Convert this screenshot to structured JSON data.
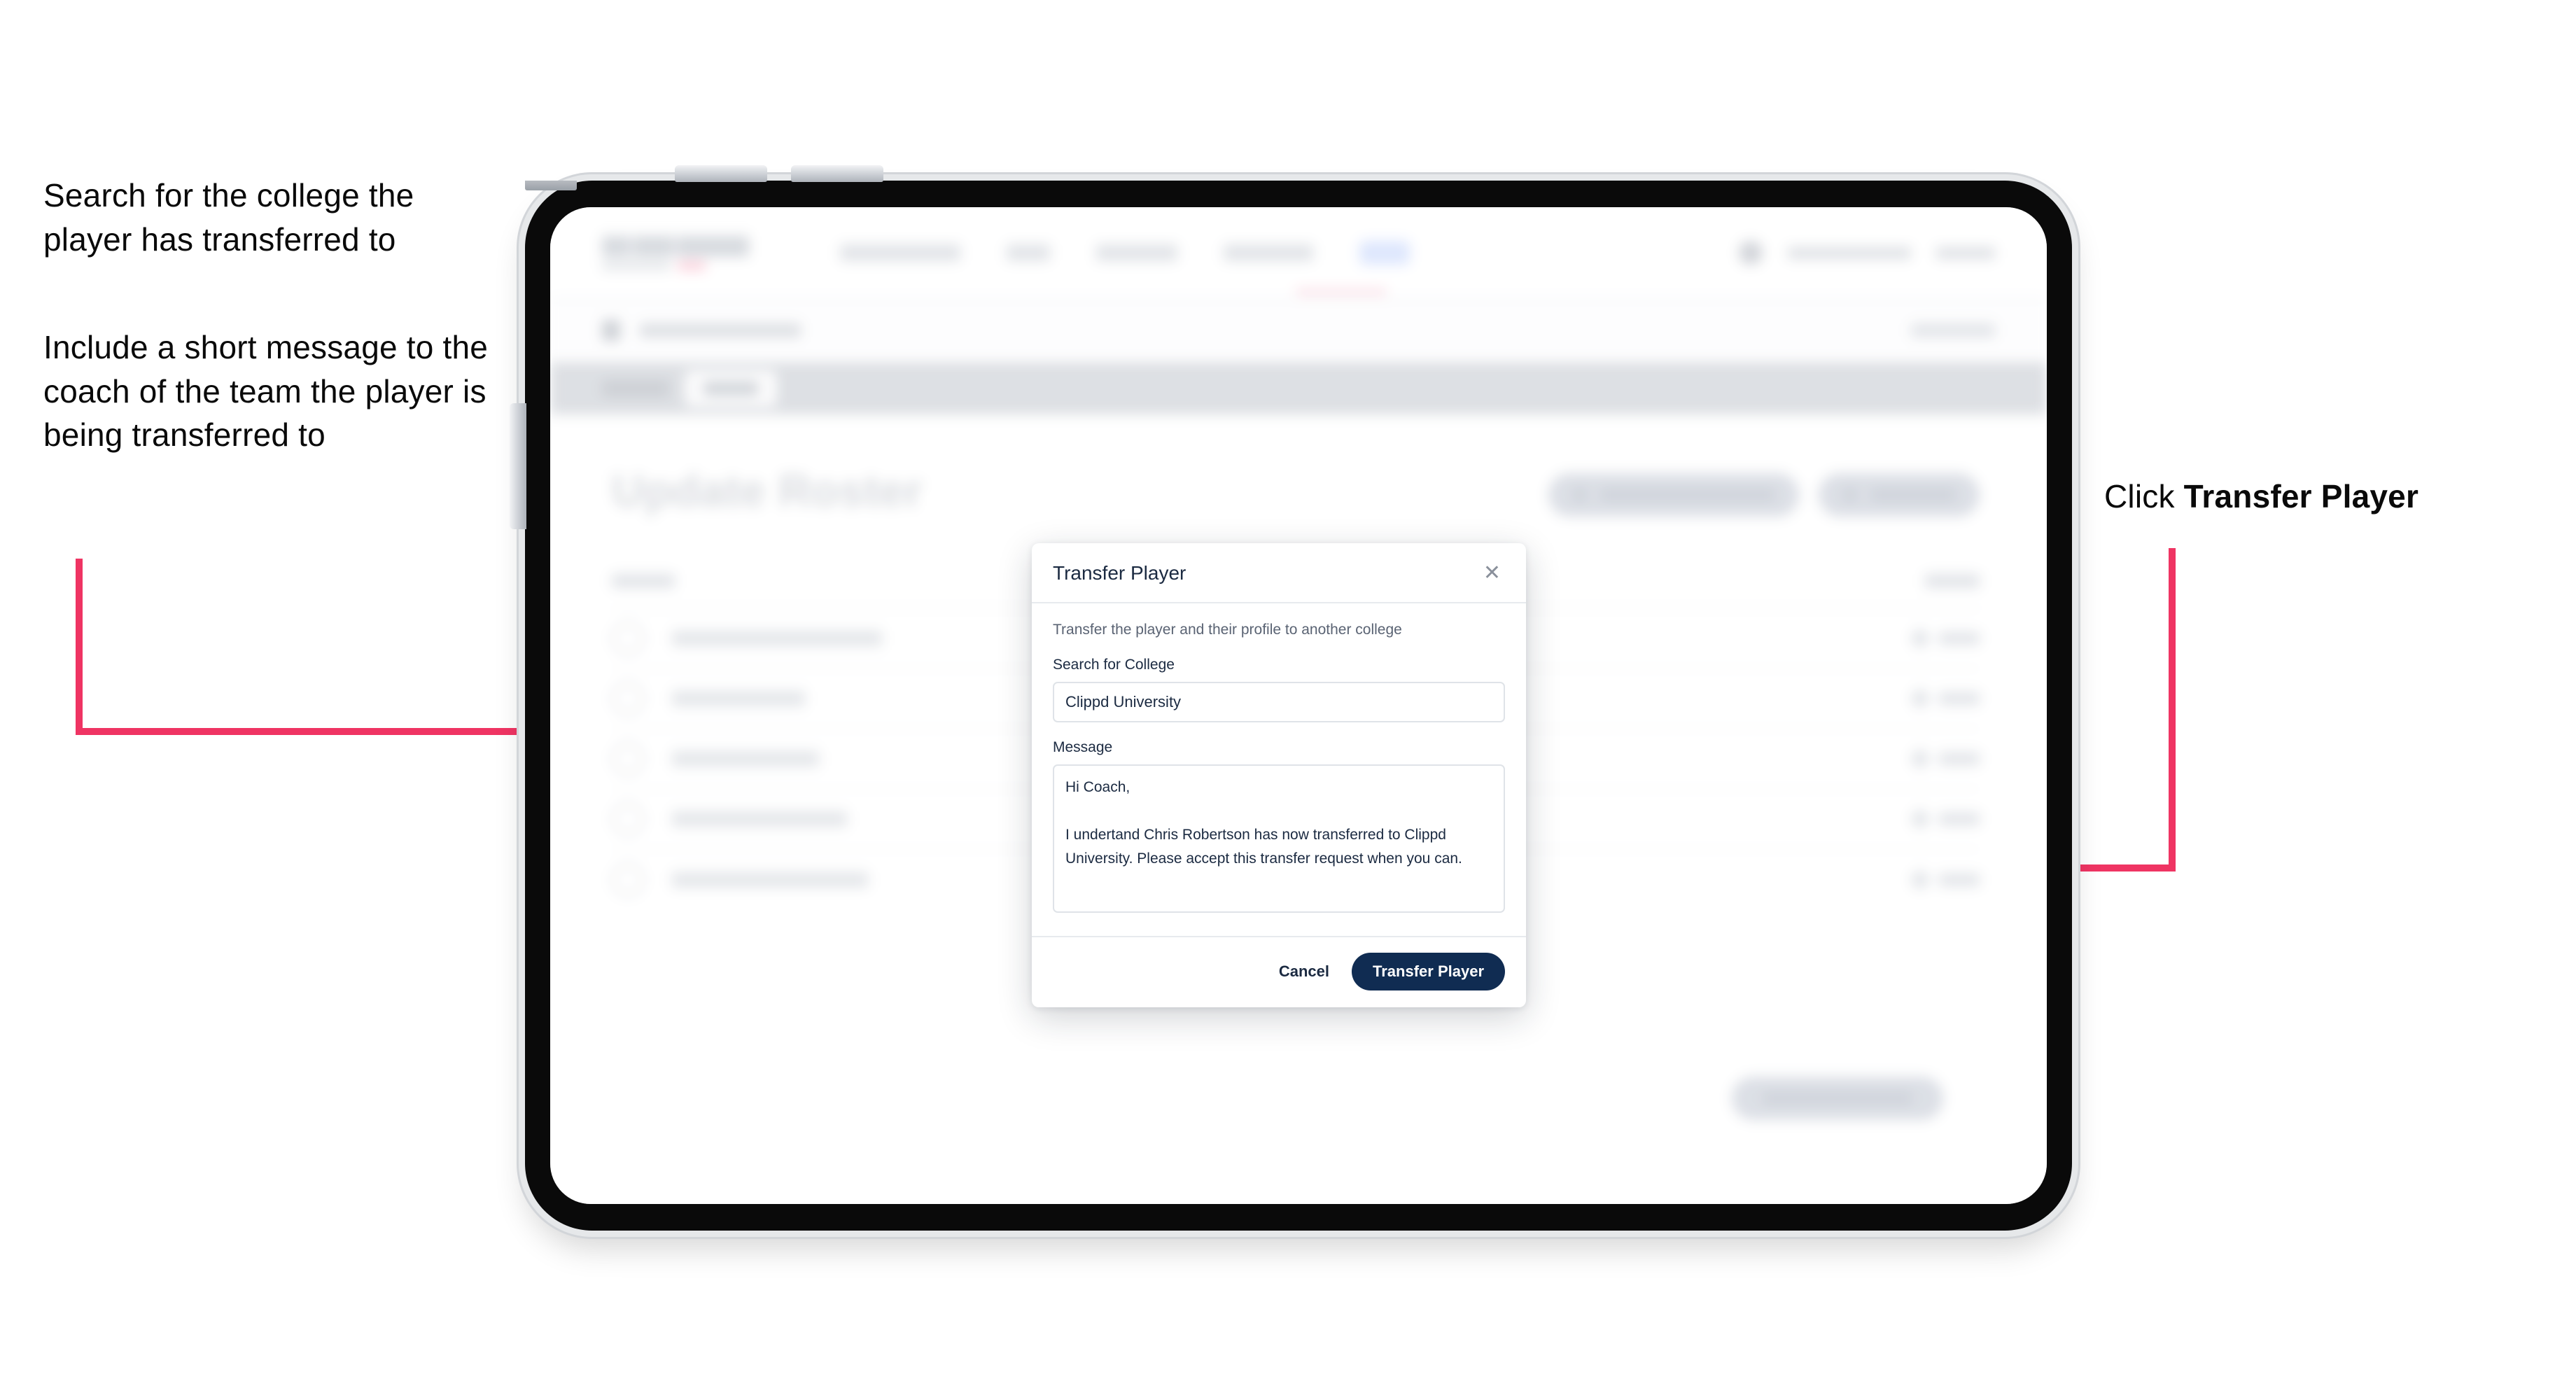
{
  "annotations": {
    "left_1": "Search for the college the player has transferred to",
    "left_2": "Include a short message to the coach of the team the player is being transferred to",
    "right_prefix": "Click ",
    "right_bold": "Transfer Player"
  },
  "app": {
    "page_title": "Update Roster"
  },
  "modal": {
    "title": "Transfer Player",
    "close_icon": "close-icon",
    "subtitle": "Transfer the player and their profile to another college",
    "college_label": "Search for College",
    "college_value": "Clippd University",
    "college_placeholder": "Search for College",
    "message_label": "Message",
    "message_value": "Hi Coach,\n\nI undertand Chris Robertson has now transferred to Clippd University. Please accept this transfer request when you can.",
    "message_placeholder": "Message",
    "cancel_label": "Cancel",
    "submit_label": "Transfer Player"
  },
  "colors": {
    "accent_pink": "#ef3463",
    "primary_navy": "#102c52",
    "text_dark": "#1b2a41",
    "muted": "#5a6373"
  }
}
